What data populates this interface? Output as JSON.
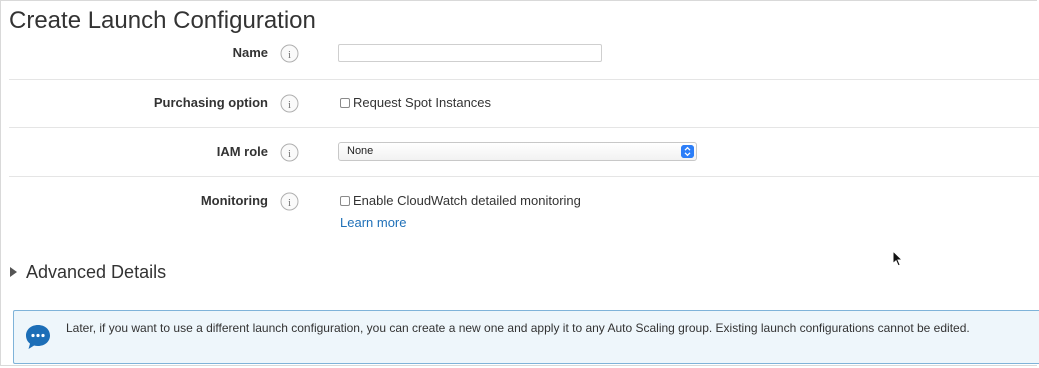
{
  "page": {
    "title": "Create Launch Configuration"
  },
  "form": {
    "name": {
      "label": "Name",
      "value": "",
      "placeholder": ""
    },
    "purchasing_option": {
      "label": "Purchasing option",
      "checkbox_label": "Request Spot Instances",
      "checked": false
    },
    "iam_role": {
      "label": "IAM role",
      "selected": "None"
    },
    "monitoring": {
      "label": "Monitoring",
      "checkbox_label": "Enable CloudWatch detailed monitoring",
      "checked": false,
      "link_label": "Learn more"
    }
  },
  "advanced": {
    "label": "Advanced Details",
    "expanded": false
  },
  "notice": {
    "text": "Later, if you want to use a different launch configuration, you can create a new one and apply it to any Auto Scaling group. Existing launch configurations cannot be edited."
  },
  "icons": {
    "info": "info-icon",
    "checkbox": "checkbox-icon",
    "select_arrows": "select-arrows-icon",
    "disclosure": "caret-right-icon",
    "notice": "speech-bubble-icon",
    "cursor": "mouse-pointer-icon"
  },
  "colors": {
    "link": "#1f70b8",
    "notice_background": "#eef6fb",
    "notice_border": "#7fb3d9",
    "notice_icon": "#1c6eb7",
    "select_stepper": "#2c7ef8",
    "divider": "#e5e5e5"
  }
}
